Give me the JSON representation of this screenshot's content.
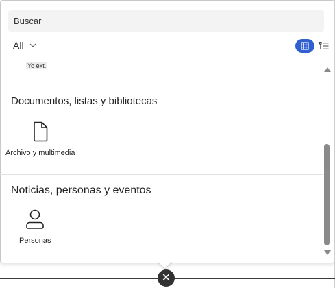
{
  "search": {
    "placeholder": "Buscar"
  },
  "filter": {
    "selected": "All"
  },
  "sections": {
    "partial": {
      "item_label": "Yo ext."
    },
    "documents": {
      "title": "Documentos, listas y bibliotecas",
      "items": [
        {
          "label": "Archivo y multimedia",
          "icon": "file-icon"
        }
      ]
    },
    "news": {
      "title": "Noticias, personas y eventos",
      "items": [
        {
          "label": "Personas",
          "icon": "person-icon"
        }
      ]
    }
  },
  "view_toggle": {
    "active": "grid",
    "accent": "#2f5fd0"
  },
  "close": {
    "glyph": "✕"
  }
}
